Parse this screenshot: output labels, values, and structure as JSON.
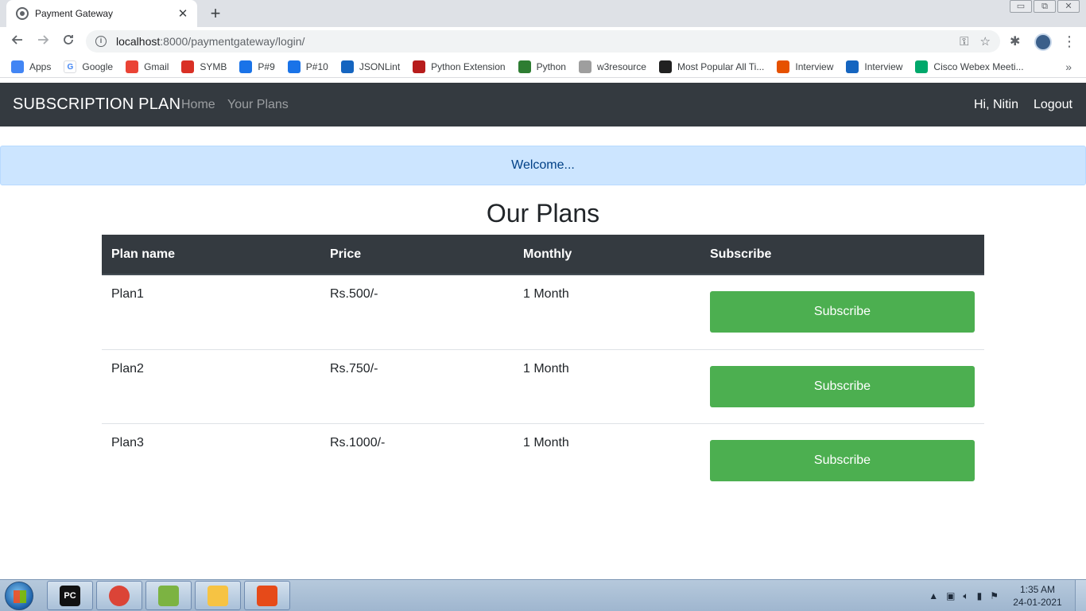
{
  "browser": {
    "tab_title": "Payment Gateway",
    "tab_close": "✕",
    "new_tab": "+",
    "url_host": "localhost",
    "url_rest": ":8000/paymentgateway/login/",
    "window_controls": [
      "▭",
      "⧉",
      "✕"
    ],
    "bookmarks": [
      {
        "label": "Apps",
        "icon": "apps-grid-icon",
        "color": "#4285f4"
      },
      {
        "label": "Google",
        "icon": "google-icon",
        "color": "#ffffff"
      },
      {
        "label": "Gmail",
        "icon": "gmail-icon",
        "color": "#ea4335"
      },
      {
        "label": "SYMB",
        "icon": "symb-icon",
        "color": "#d93025"
      },
      {
        "label": "P#9",
        "icon": "drive-icon",
        "color": "#1a73e8"
      },
      {
        "label": "P#10",
        "icon": "drive-icon",
        "color": "#1a73e8"
      },
      {
        "label": "JSONLint",
        "icon": "json-icon",
        "color": "#1565c0"
      },
      {
        "label": "Python Extension",
        "icon": "python-ext-icon",
        "color": "#b71c1c"
      },
      {
        "label": "Python",
        "icon": "w3schools-icon",
        "color": "#2e7d32"
      },
      {
        "label": "w3resource",
        "icon": "w3r-icon",
        "color": "#9e9e9e"
      },
      {
        "label": "Most Popular All Ti...",
        "icon": "flag-icon",
        "color": "#212121"
      },
      {
        "label": "Interview",
        "icon": "interview-icon",
        "color": "#e65100"
      },
      {
        "label": "Interview",
        "icon": "e-icon",
        "color": "#1565c0"
      },
      {
        "label": "Cisco Webex Meeti...",
        "icon": "webex-icon",
        "color": "#00a86b"
      }
    ],
    "bookmarks_more": "»"
  },
  "site": {
    "brand": "SUBSCRIPTION PLAN",
    "nav": [
      "Home",
      "Your Plans"
    ],
    "greeting": "Hi, Nitin",
    "logout": "Logout",
    "alert": "Welcome...",
    "heading": "Our Plans",
    "columns": [
      "Plan name",
      "Price",
      "Monthly",
      "Subscribe"
    ],
    "plans": [
      {
        "name": "Plan1",
        "price": "Rs.500/-",
        "duration": "1 Month",
        "button": "Subscribe"
      },
      {
        "name": "Plan2",
        "price": "Rs.750/-",
        "duration": "1 Month",
        "button": "Subscribe"
      },
      {
        "name": "Plan3",
        "price": "Rs.1000/-",
        "duration": "1 Month",
        "button": "Subscribe"
      }
    ],
    "colors": {
      "navbar": "#343a40",
      "alert_bg": "#cce5ff",
      "button": "#4caf50"
    }
  },
  "taskbar": {
    "apps": [
      {
        "label": "PC",
        "icon": "pycharm-icon",
        "color": "#111111"
      },
      {
        "label": "",
        "icon": "chrome-icon",
        "color": "#db4437"
      },
      {
        "label": "",
        "icon": "notepadpp-icon",
        "color": "#7cb342"
      },
      {
        "label": "",
        "icon": "file-explorer-icon",
        "color": "#f6c343"
      },
      {
        "label": "",
        "icon": "git-icon",
        "color": "#e64a19"
      }
    ],
    "time": "1:35 AM",
    "date": "24-01-2021"
  }
}
